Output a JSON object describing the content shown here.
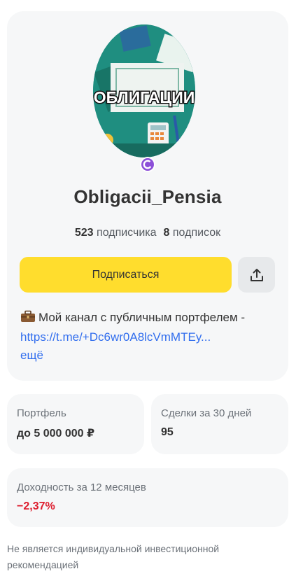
{
  "profile": {
    "avatar_text": "ОБЛИГАЦИИ",
    "brand_icon": "c-circle-icon",
    "name": "Obligacii_Pensia",
    "followers_count": "523",
    "followers_label": "подписчика",
    "following_count": "8",
    "following_label": "подписок",
    "subscribe_label": "Подписаться",
    "share_icon": "share-upload-icon",
    "description_emoji": "briefcase-icon",
    "description_text": "Мой канал с публичным портфелем -",
    "description_link": "https://t.me/+Dc6wr0A8lcVmMTEy...",
    "more_label": "ещё"
  },
  "metrics": {
    "portfolio": {
      "label": "Портфель",
      "value": "до 5 000 000 ₽"
    },
    "deals": {
      "label": "Сделки за 30 дней",
      "value": "95"
    },
    "yield": {
      "label": "Доходность за 12 месяцев",
      "value": "−2,37%"
    }
  },
  "disclaimer": "Не является индивидуальной инвестиционной рекомендацией",
  "colors": {
    "accent_yellow": "#ffdd2d",
    "link_blue": "#336fee",
    "negative_red": "#dd1b2c",
    "card_bg": "#f6f7f8"
  }
}
